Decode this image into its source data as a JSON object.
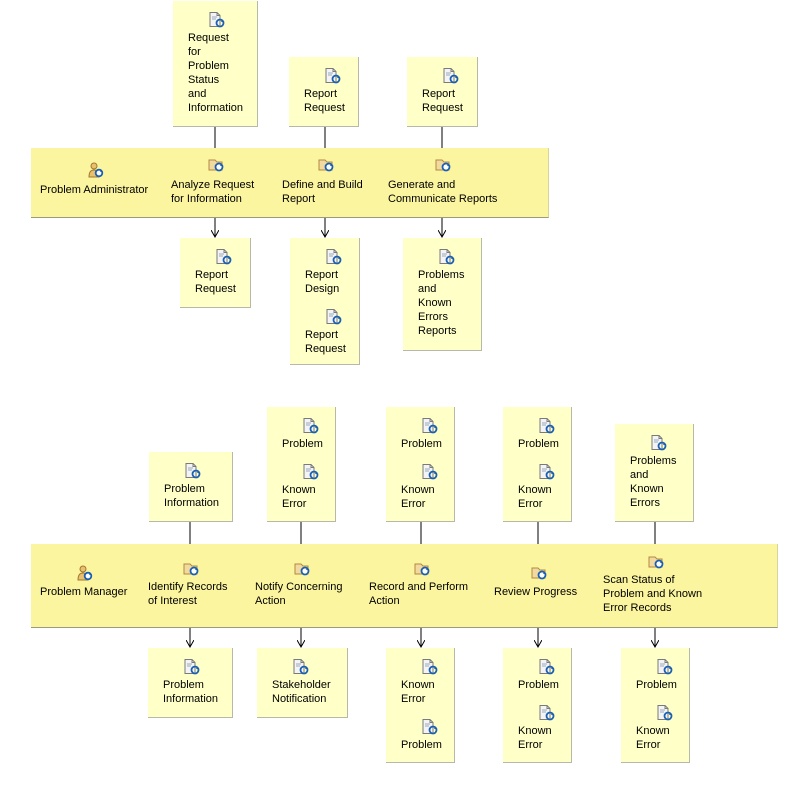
{
  "colors": {
    "lane": "#fbf59f",
    "artifact": "#ffffc8",
    "connector": "#000000"
  },
  "lanes": [
    {
      "role": "Problem Administrator",
      "role_icon": "role-person-icon",
      "tasks": [
        {
          "label": "Analyze Request\nfor Information",
          "inputs": [
            "Request\nfor\nProblem\nStatus\nand\nInformation"
          ],
          "outputs": [
            "Report\nRequest"
          ]
        },
        {
          "label": "Define and Build\nReport",
          "inputs": [
            "Report\nRequest"
          ],
          "outputs": [
            "Report\nDesign",
            "Report\nRequest"
          ]
        },
        {
          "label": "Generate and\nCommunicate Reports",
          "inputs": [
            "Report\nRequest"
          ],
          "outputs": [
            "Problems\nand\nKnown\nErrors\nReports"
          ]
        }
      ]
    },
    {
      "role": "Problem Manager",
      "role_icon": "role-person-icon",
      "tasks": [
        {
          "label": "Identify Records\nof Interest",
          "inputs": [
            "Problem\nInformation"
          ],
          "outputs": [
            "Problem\nInformation"
          ]
        },
        {
          "label": "Notify Concerning\nAction",
          "inputs": [
            "Problem",
            "Known\nError"
          ],
          "outputs": [
            "Stakeholder\nNotification"
          ]
        },
        {
          "label": "Record and Perform\nAction",
          "inputs": [
            "Problem",
            "Known\nError"
          ],
          "outputs": [
            "Known\nError",
            "Problem"
          ]
        },
        {
          "label": "Review Progress",
          "inputs": [
            "Problem",
            "Known\nError"
          ],
          "outputs": [
            "Problem",
            "Known\nError"
          ]
        },
        {
          "label": "Scan Status of\nProblem and Known\nError Records",
          "inputs": [
            "Problems\nand\nKnown\nErrors"
          ],
          "outputs": [
            "Problem",
            "Known\nError"
          ]
        }
      ]
    }
  ]
}
